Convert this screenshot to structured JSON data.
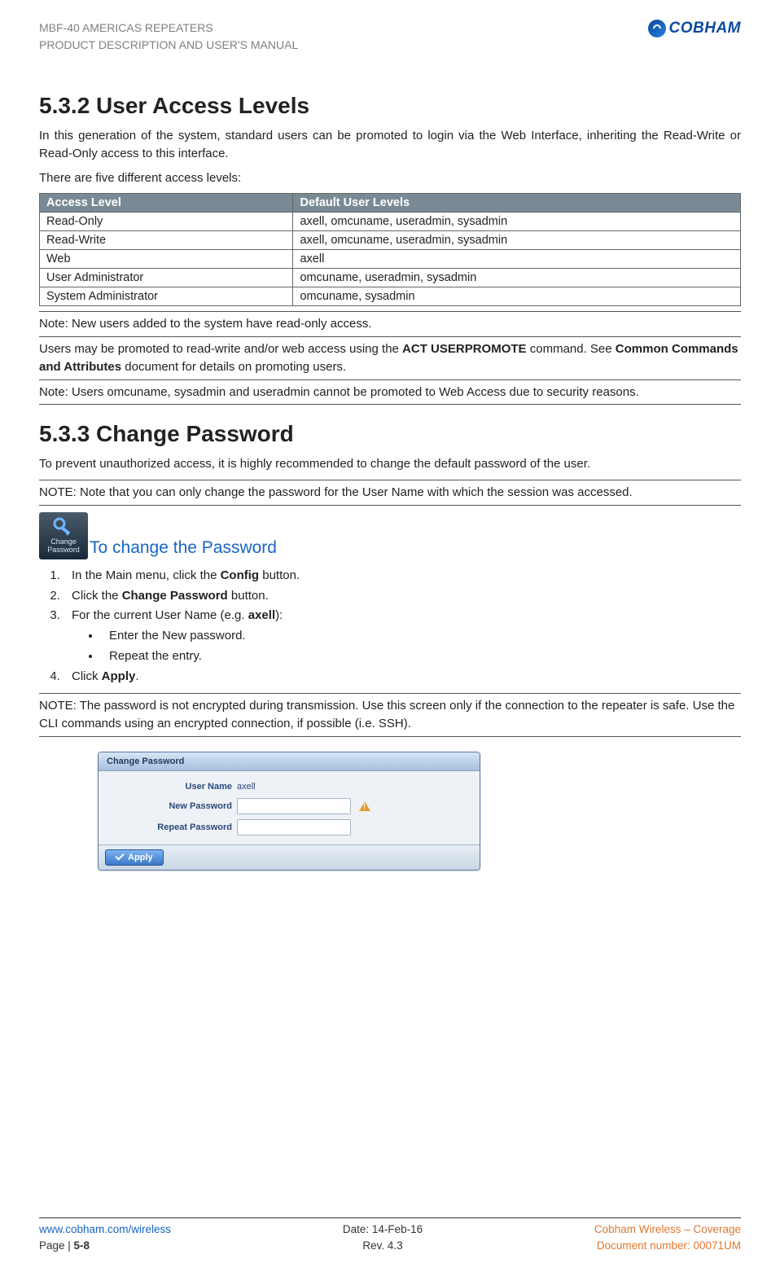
{
  "header": {
    "line1": "MBF-40 AMERICAS REPEATERS",
    "line2": "PRODUCT DESCRIPTION AND USER'S MANUAL",
    "logo_text": "COBHAM"
  },
  "section1": {
    "number_title": "5.3.2   User Access Levels",
    "para1": "In this generation of the system, standard users can be promoted to login via the Web Interface, inheriting the Read-Write or Read-Only access to this interface.",
    "para2": "There are five different access levels:",
    "table": {
      "head": [
        "Access Level",
        "Default User Levels"
      ],
      "rows": [
        [
          "Read-Only",
          "axell, omcuname, useradmin, sysadmin"
        ],
        [
          "Read-Write",
          "axell, omcuname, useradmin, sysadmin"
        ],
        [
          "Web",
          "axell"
        ],
        [
          "User Administrator",
          "omcuname, useradmin, sysadmin"
        ],
        [
          "System Administrator",
          "omcuname, sysadmin"
        ]
      ]
    },
    "note1": "Note: New users added to the system have read-only access.",
    "note2_pre": "Users may be promoted to read-write and/or web access using the ",
    "note2_cmd": "ACT USERPROMOTE",
    "note2_mid": " command. See ",
    "note2_doc": "Common Commands and Attributes",
    "note2_post": " document for details on promoting users.",
    "note3": "Note: Users omcuname, sysadmin and useradmin cannot be promoted to Web Access due to security reasons."
  },
  "section2": {
    "number_title": "5.3.3   Change Password",
    "para1": "To prevent unauthorized access, it is highly recommended to change the default password of the user.",
    "note_a": "NOTE: Note that you can only change the password for the User Name with which the session was accessed.",
    "icon_label1": "Change",
    "icon_label2": "Password",
    "sub_heading": "To change the Password",
    "steps": {
      "s1_pre": "In the Main menu, click the ",
      "s1_b": "Config",
      "s1_post": " button.",
      "s2_pre": "Click the ",
      "s2_b": "Change Password",
      "s2_post": " button.",
      "s3_pre": "For the current User Name (e.g. ",
      "s3_b": "axell",
      "s3_post": "):",
      "bullet1": "Enter the New password.",
      "bullet2": "Repeat the entry.",
      "s4_pre": "Click ",
      "s4_b": "Apply",
      "s4_post": "."
    },
    "note_b": "NOTE: The password is not encrypted during transmission. Use this screen only if the connection to the repeater is safe. Use the CLI commands using an encrypted connection, if possible (i.e. SSH).",
    "dialog": {
      "title": "Change Password",
      "labels": {
        "user": "User Name",
        "new": "New Password",
        "repeat": "Repeat Password"
      },
      "username_value": "axell",
      "apply": "Apply"
    }
  },
  "footer": {
    "url": "www.cobham.com/wireless",
    "page_lbl": "Page | ",
    "page_num": "5-8",
    "date": "Date: 14-Feb-16",
    "rev": "Rev. 4.3",
    "brand": "Cobham Wireless – Coverage",
    "doc": "Document number: 00071UM"
  }
}
